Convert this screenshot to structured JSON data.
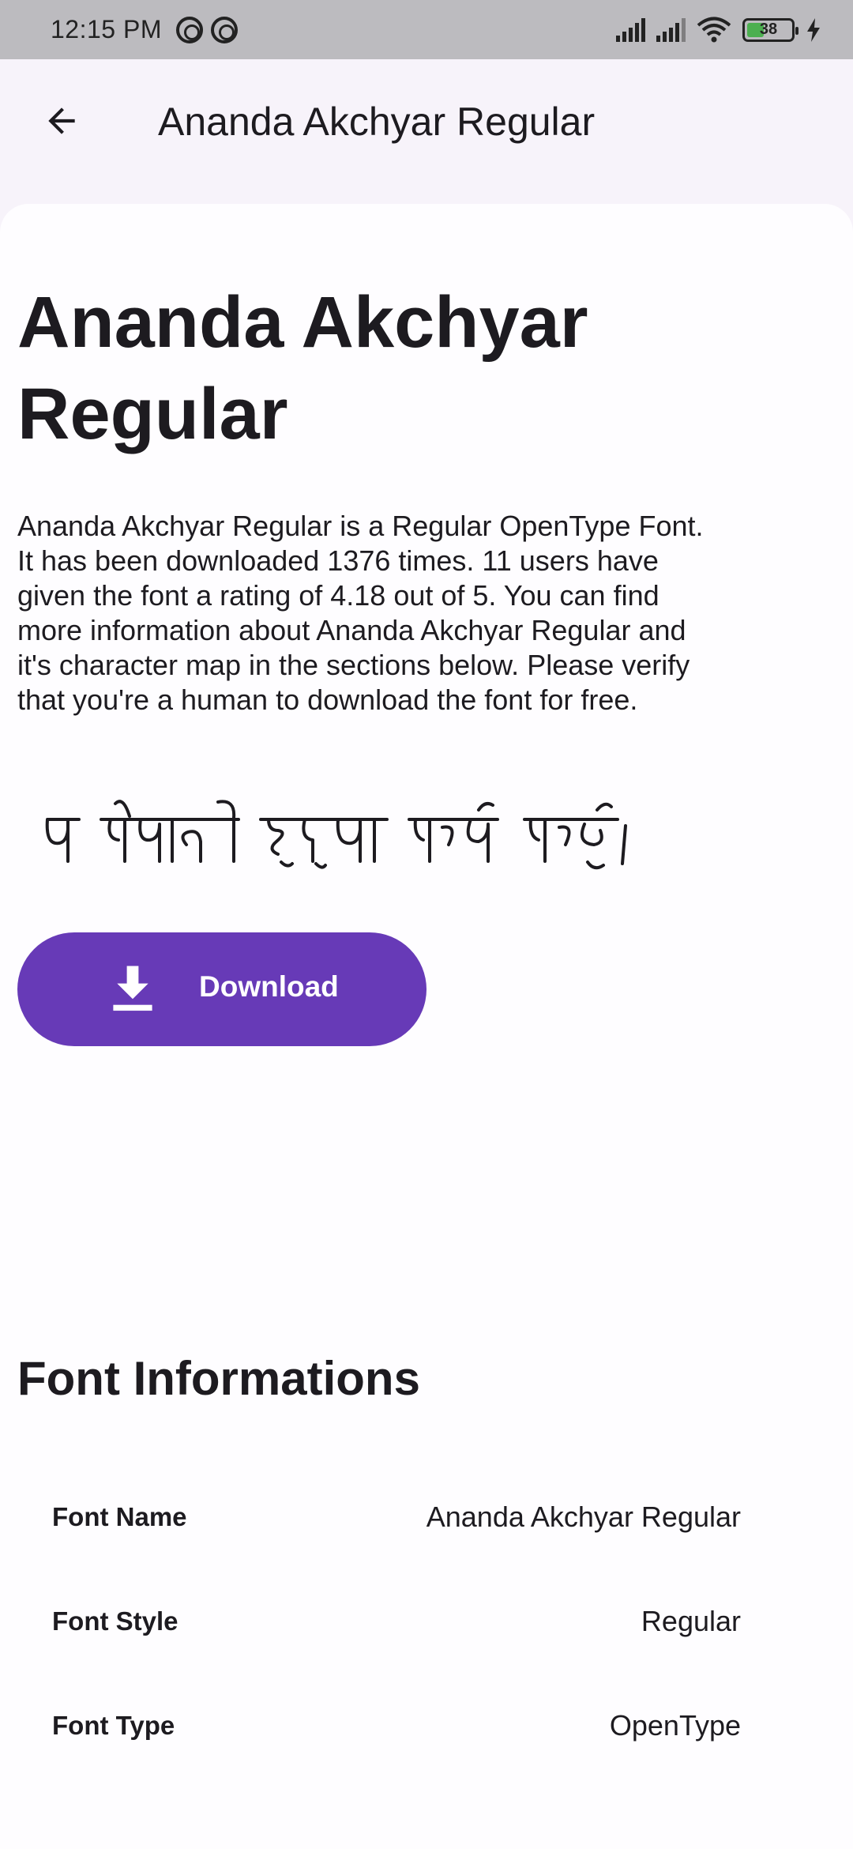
{
  "status_bar": {
    "time": "12:15 PM",
    "battery_level": "38",
    "battery_fraction": 0.38,
    "icons": [
      "notification-icon",
      "notification-icon",
      "cell-signal-icon",
      "cell-signal-icon",
      "wifi-icon",
      "battery-icon",
      "charging-icon"
    ]
  },
  "app_bar": {
    "back_icon": "arrow-back-icon",
    "title": "Ananda Akchyar Regular"
  },
  "content": {
    "title": "Ananda Akchyar Regular",
    "description": " Ananda Akchyar Regular  is a Regular OpenType Font. It has been downloaded 1376 times. 11 users have given the font a rating of 4.18 out of 5. You can find more information about Ananda Akchyar Regular and it's character map in the sections below. Please verify that you're a human to download the font for free.",
    "preview_text": "म नेपाली हुनुमा गर्व गर्छु ।",
    "download_label": "Download",
    "download_icon": "download-icon"
  },
  "font_info": {
    "heading": "Font Informations",
    "rows": [
      {
        "label": "Font Name",
        "value": "Ananda Akchyar Regular"
      },
      {
        "label": "Font Style",
        "value": "Regular"
      },
      {
        "label": "Font Type",
        "value": "OpenType"
      }
    ]
  },
  "colors": {
    "accent": "#673ab7",
    "background": "#f7f3fa",
    "card": "#fefdff",
    "status_bar": "#bcbbbf"
  }
}
